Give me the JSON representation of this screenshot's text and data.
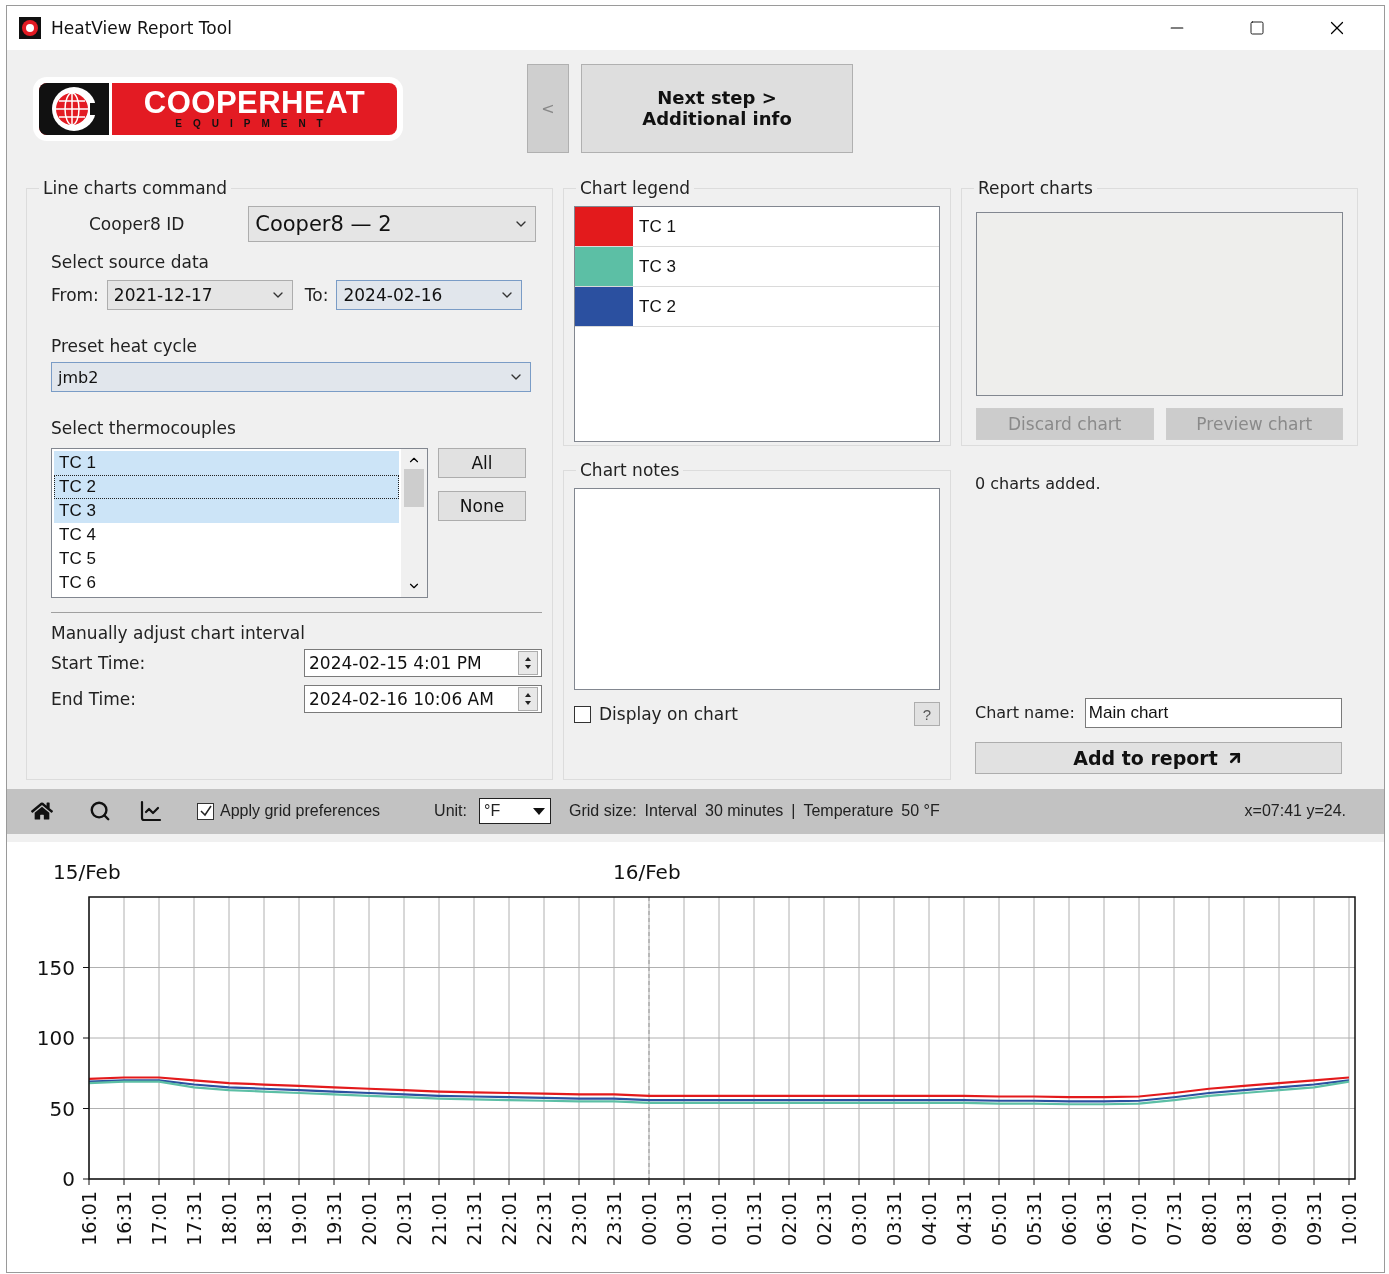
{
  "window": {
    "title": "HeatView Report Tool"
  },
  "header": {
    "logo": {
      "name": "COOPERHEAT",
      "tagline": "EQUIPMENT"
    },
    "back_button": "<",
    "next_button": [
      "Next step >",
      "Additional info"
    ]
  },
  "line_charts_command": {
    "title": "Line charts command",
    "cooper8_id": {
      "label": "Cooper8 ID",
      "value": "Cooper8 — 2"
    },
    "source_data": {
      "title": "Select source data",
      "from_label": "From:",
      "from_value": "2021-12-17",
      "to_label": "To:",
      "to_value": "2024-02-16"
    },
    "preset": {
      "title": "Preset heat cycle",
      "value": "jmb2"
    },
    "thermocouples": {
      "title": "Select thermocouples",
      "items": [
        {
          "label": "TC 1",
          "selected": true,
          "focused": false
        },
        {
          "label": "TC 2",
          "selected": true,
          "focused": true
        },
        {
          "label": "TC 3",
          "selected": true,
          "focused": false
        },
        {
          "label": "TC 4",
          "selected": false,
          "focused": false
        },
        {
          "label": "TC 5",
          "selected": false,
          "focused": false
        },
        {
          "label": "TC 6",
          "selected": false,
          "focused": false
        }
      ],
      "buttons": [
        "All",
        "None"
      ]
    },
    "interval": {
      "title": "Manually adjust chart interval",
      "start": {
        "label": "Start Time:",
        "value": "2024-02-15 4:01 PM"
      },
      "end": {
        "label": "End Time:",
        "value": "2024-02-16 10:06 AM"
      }
    }
  },
  "chart_legend": {
    "title": "Chart legend",
    "items": [
      {
        "label": "TC 1",
        "color": "#e31a1c"
      },
      {
        "label": "TC 3",
        "color": "#5cbfa5"
      },
      {
        "label": "TC 2",
        "color": "#2b50a0"
      }
    ]
  },
  "chart_notes": {
    "title": "Chart notes",
    "display_on_chart": {
      "label": "Display on chart",
      "checked": false
    },
    "help": "?"
  },
  "report_charts": {
    "title": "Report charts",
    "buttons": [
      {
        "label": "Discard chart",
        "disabled": true
      },
      {
        "label": "Preview chart",
        "disabled": true
      }
    ],
    "status": "0 charts added.",
    "chart_name": {
      "label": "Chart name:",
      "value": "Main chart"
    },
    "add_button": "Add to report"
  },
  "toolbar": {
    "apply_grid": {
      "label": "Apply grid preferences",
      "checked": true
    },
    "unit": {
      "label": "Unit:",
      "value": "°F"
    },
    "grid_size": [
      "Grid size:",
      "Interval",
      "30 minutes",
      "|",
      "Temperature",
      "50 °F"
    ],
    "coordinates": "x=07:41 y=24."
  },
  "chart": {
    "chart_data": {
      "type": "line",
      "categories": [
        "16:01",
        "16:31",
        "17:01",
        "17:31",
        "18:01",
        "18:31",
        "19:01",
        "19:31",
        "20:01",
        "20:31",
        "21:01",
        "21:31",
        "22:01",
        "22:31",
        "23:01",
        "23:31",
        "00:01",
        "00:31",
        "01:01",
        "01:31",
        "02:01",
        "02:31",
        "03:01",
        "03:31",
        "04:01",
        "04:31",
        "05:01",
        "05:31",
        "06:01",
        "06:31",
        "07:01",
        "07:31",
        "08:01",
        "08:31",
        "09:01",
        "09:31",
        "10:01"
      ],
      "series": [
        {
          "color": "#e31a1c",
          "values": [
            71,
            72,
            72,
            70,
            68,
            67,
            66,
            65,
            64,
            63,
            62,
            61.5,
            61,
            60.5,
            60,
            60,
            59,
            59,
            59,
            59,
            59,
            59,
            59,
            59,
            59,
            59,
            58.5,
            58.5,
            58,
            58,
            58.5,
            61,
            64,
            66,
            68,
            70,
            72
          ]
        },
        {
          "color": "#2b50a0",
          "values": [
            69,
            70,
            70,
            67,
            65,
            64,
            63,
            62,
            61,
            60,
            59,
            58.5,
            58,
            57.5,
            57,
            57,
            56,
            56,
            56,
            56,
            56,
            56,
            56,
            56,
            56,
            56,
            55.5,
            55.5,
            55,
            55,
            55.5,
            58,
            61,
            63,
            65,
            67,
            70
          ]
        },
        {
          "color": "#5cbfa5",
          "values": [
            68,
            69,
            69,
            65,
            63,
            62,
            61,
            60,
            59,
            58,
            57,
            56.5,
            56,
            55.5,
            55,
            55,
            54,
            54,
            54,
            54,
            54,
            54,
            54,
            54,
            54,
            54,
            53.5,
            53.5,
            53,
            53,
            53.5,
            56,
            59,
            61,
            63,
            65,
            69
          ]
        }
      ],
      "ylim": [
        0,
        200
      ],
      "yticks": [
        0,
        50,
        100,
        150
      ],
      "grid": true,
      "ref_lines": [
        {
          "axis": "x",
          "value": "00:01"
        }
      ],
      "annotations": [
        "15/Feb",
        "16/Feb"
      ]
    }
  }
}
